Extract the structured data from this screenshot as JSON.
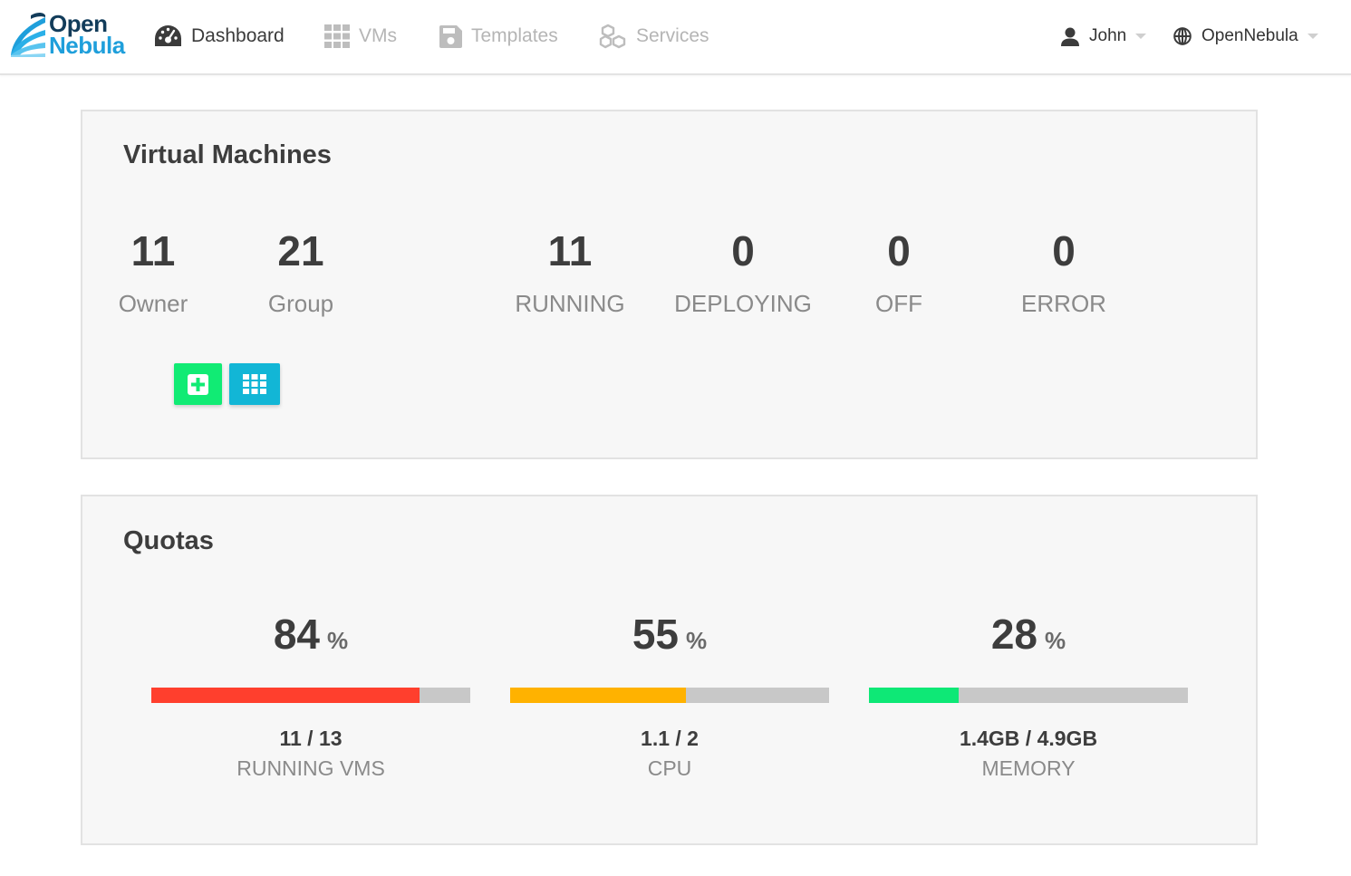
{
  "brand": {
    "line1": "Open",
    "line2": "Nebula"
  },
  "nav": {
    "dashboard": "Dashboard",
    "vms": "VMs",
    "templates": "Templates",
    "services": "Services"
  },
  "user_menu": {
    "user": "John",
    "zone": "OpenNebula"
  },
  "vm_panel": {
    "title": "Virtual Machines",
    "stats": [
      {
        "value": "11",
        "label": "Owner"
      },
      {
        "value": "21",
        "label": "Group"
      },
      {
        "value": "11",
        "label": "RUNNING"
      },
      {
        "value": "0",
        "label": "DEPLOYING"
      },
      {
        "value": "0",
        "label": "OFF"
      },
      {
        "value": "0",
        "label": "ERROR"
      }
    ]
  },
  "quotas": {
    "title": "Quotas",
    "unit": "%",
    "items": [
      {
        "percent": "84",
        "used": "11 / 13",
        "label": "RUNNING VMS",
        "fill": 0.84,
        "color": "#ff3f2d"
      },
      {
        "percent": "55",
        "used": "1.1 / 2",
        "label": "CPU",
        "fill": 0.55,
        "color": "#ffb200"
      },
      {
        "percent": "28",
        "used": "1.4GB / 4.9GB",
        "label": "MEMORY",
        "fill": 0.28,
        "color": "#0ee876"
      }
    ]
  },
  "icons": {
    "dashboard": "gauge-icon",
    "vms": "grid-icon",
    "templates": "floppy-icon",
    "services": "cubes-icon",
    "user": "user-icon",
    "zone": "globe-icon",
    "create": "plus-square-icon",
    "list": "grid-icon"
  },
  "colors": {
    "accent_green": "#11eb74",
    "accent_cyan": "#12b6d6",
    "brand_dark": "#123c5a",
    "brand_light": "#1f9fdb"
  }
}
